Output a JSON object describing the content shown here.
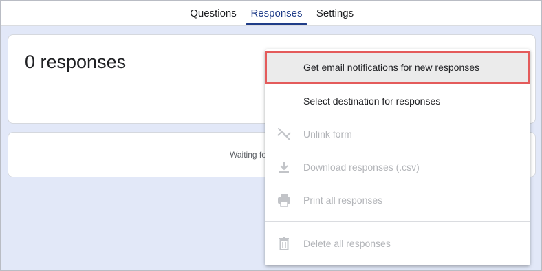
{
  "tabs": [
    {
      "label": "Questions",
      "active": false
    },
    {
      "label": "Responses",
      "active": true
    },
    {
      "label": "Settings",
      "active": false
    }
  ],
  "summary": {
    "title": "0 responses"
  },
  "status": {
    "waiting_text": "Waiting fo"
  },
  "menu": {
    "items": [
      {
        "label": "Get email notifications for new responses",
        "disabled": false,
        "highlighted": true,
        "icon": ""
      },
      {
        "label": "Select destination for responses",
        "disabled": false,
        "icon": ""
      },
      {
        "label": "Unlink form",
        "disabled": true,
        "icon": "link-off-icon"
      },
      {
        "label": "Download responses (.csv)",
        "disabled": true,
        "icon": "download-icon"
      },
      {
        "label": "Print all responses",
        "disabled": true,
        "icon": "print-icon"
      },
      {
        "label": "Delete all responses",
        "disabled": true,
        "icon": "trash-icon"
      }
    ]
  },
  "colors": {
    "accent": "#1f3c88",
    "background": "#e2e8f8",
    "highlight_border": "#e45b5b",
    "disabled_text": "#b3b5b9"
  }
}
